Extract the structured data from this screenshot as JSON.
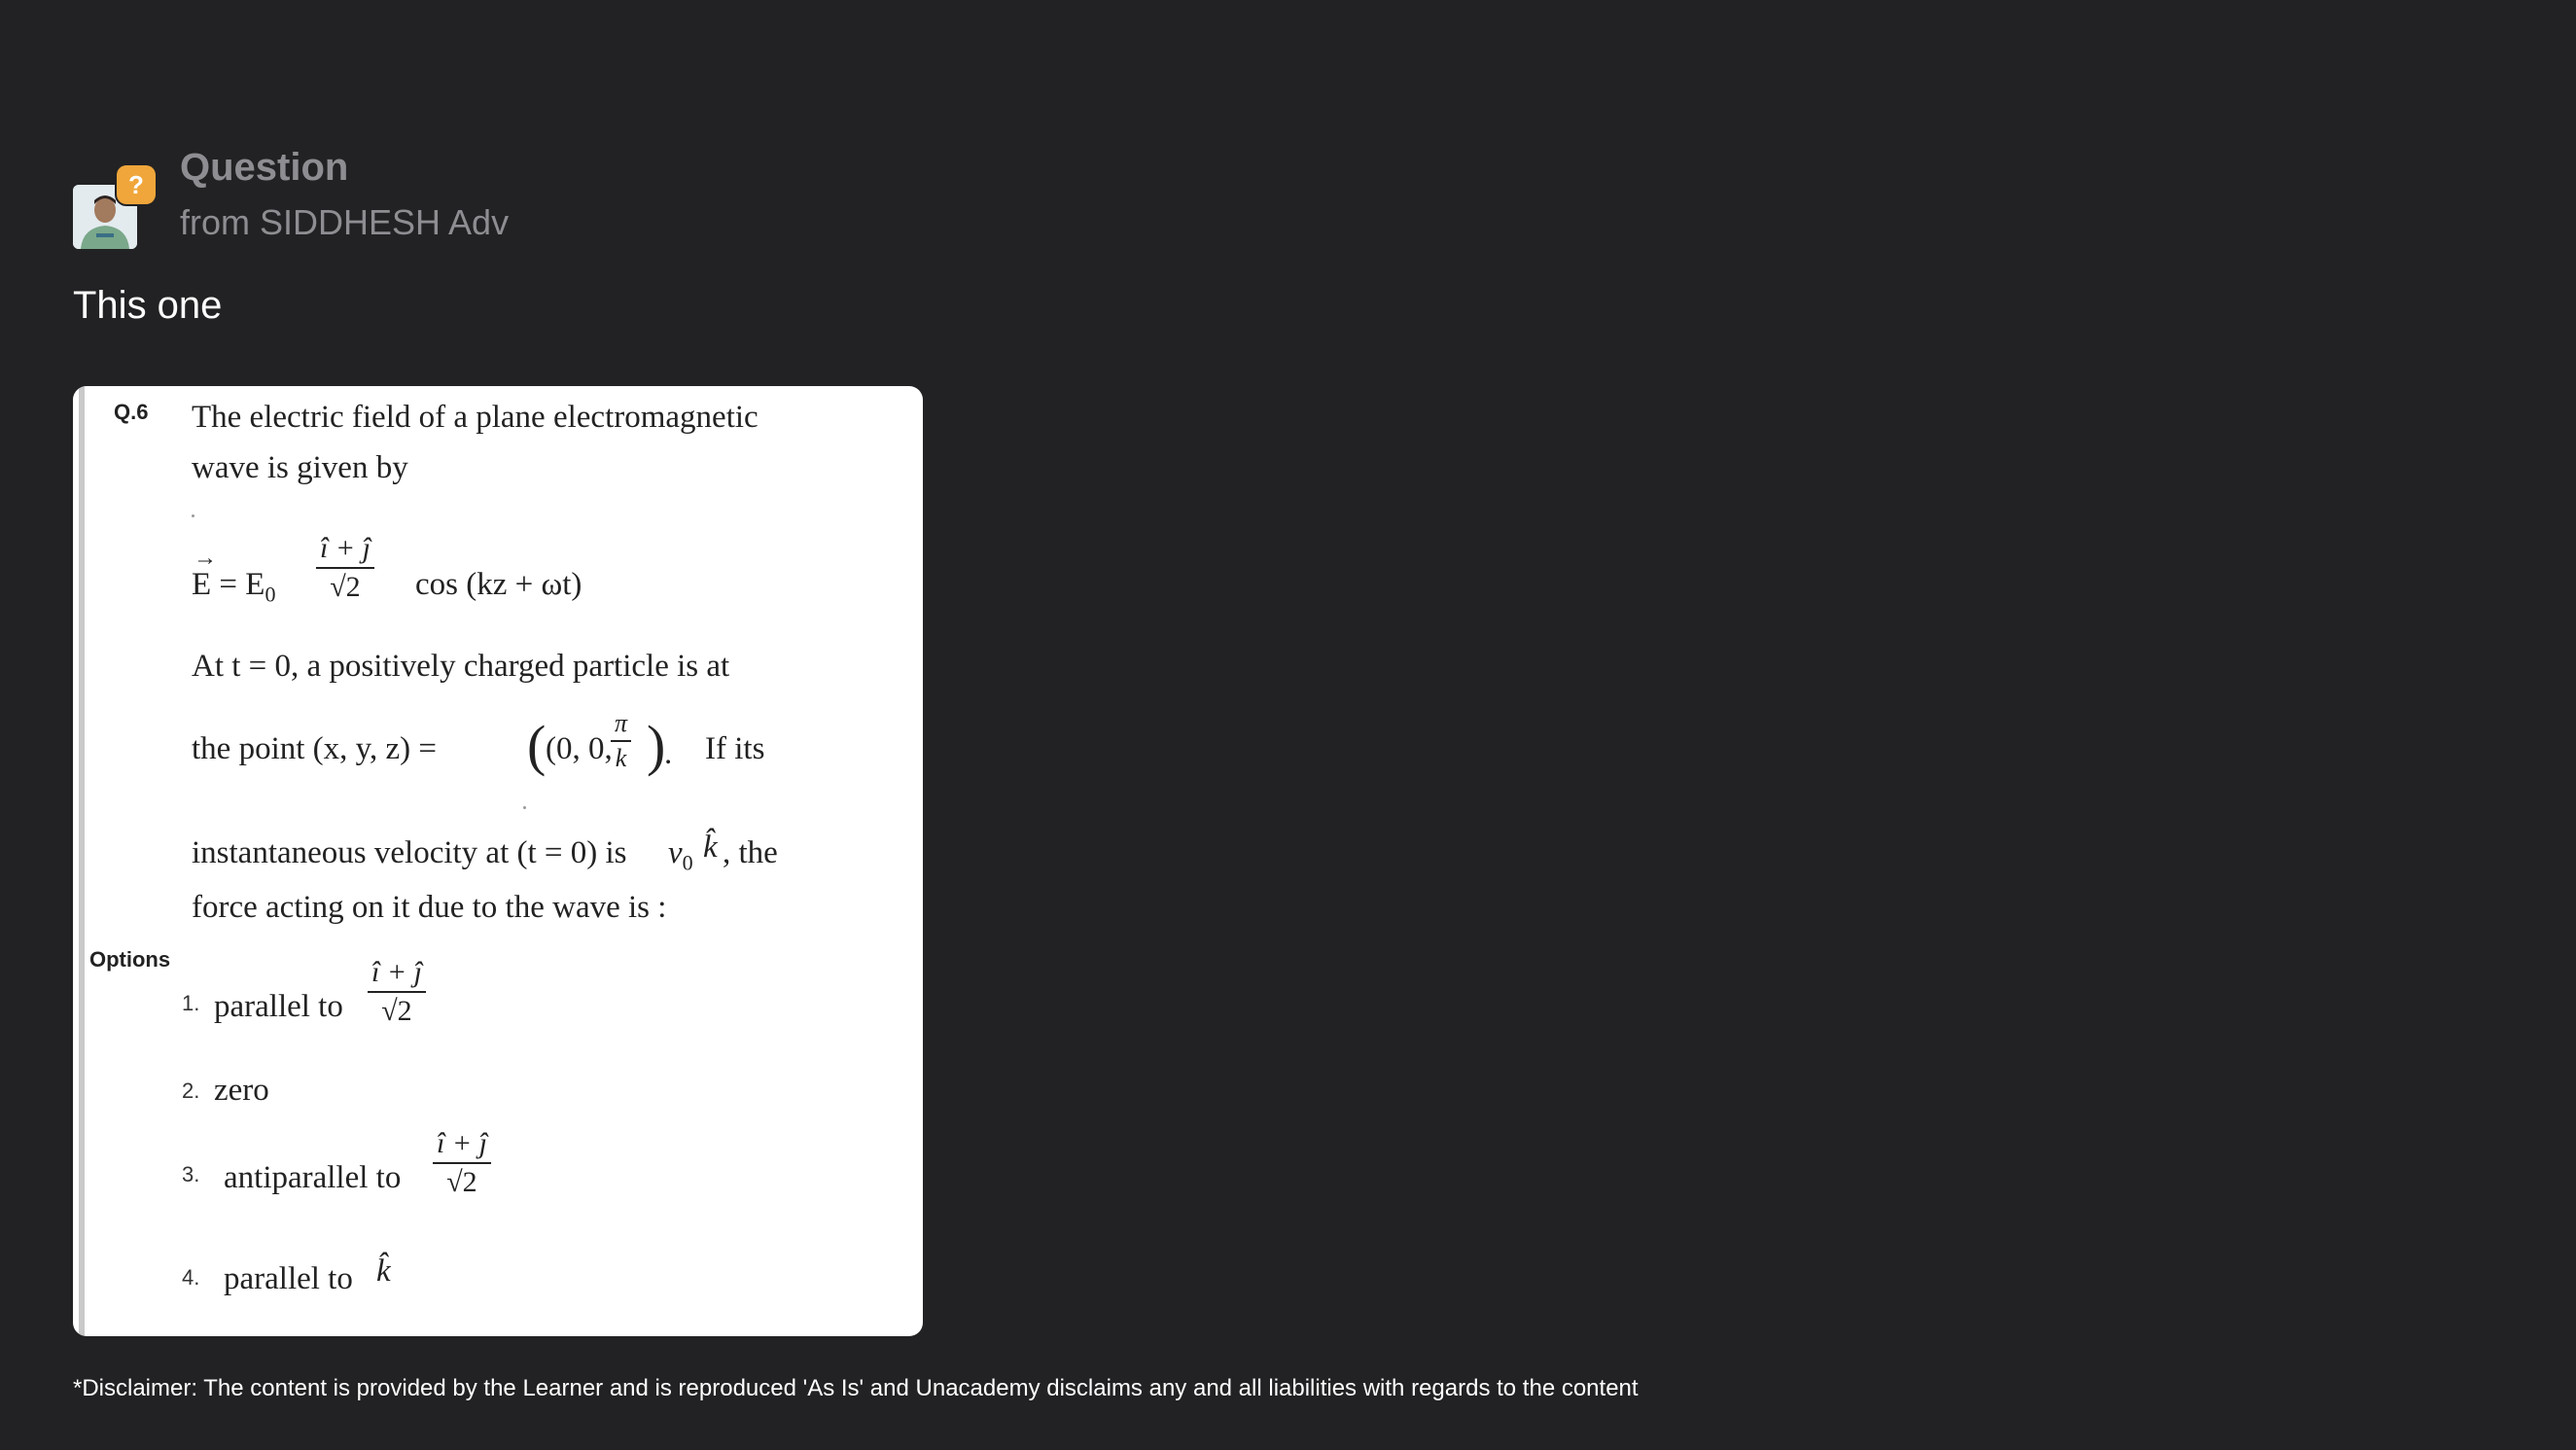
{
  "header": {
    "title": "Question",
    "subtitle": "from SIDDHESH Adv",
    "badge": "?"
  },
  "message": "This one",
  "question": {
    "number": "Q.6",
    "line1": "The electric field of a plane electromagnetic",
    "line2": "wave is given by",
    "eq_lhs": "E = E",
    "eq_sub": "0",
    "eq_num": "î + ĵ",
    "eq_den": "√2",
    "eq_rhs": "cos (kz + ωt)",
    "line3": "At t = 0, a positively charged particle is at",
    "line4_a": "the  point  (x,  y,  z) =",
    "point_open": "(0, 0,",
    "point_num": "π",
    "point_den": "k",
    "point_close": ").",
    "line4_b": "If  its",
    "line5_a": "instantaneous velocity at (t = 0) is",
    "line5_v": "v",
    "line5_vsub": "0",
    "line5_k": "k̂",
    "line5_b": ", the",
    "line6": "force acting on it due to the wave is :"
  },
  "options": {
    "label": "Options",
    "items": [
      {
        "num": "1.",
        "text": "parallel to",
        "frac_num": "î + ĵ",
        "frac_den": "√2"
      },
      {
        "num": "2.",
        "text": "zero"
      },
      {
        "num": "3.",
        "text": "antiparallel to",
        "frac_num": "î + ĵ",
        "frac_den": "√2"
      },
      {
        "num": "4.",
        "text": "parallel to",
        "suffix": "k̂"
      }
    ]
  },
  "disclaimer": "*Disclaimer: The content is provided by the Learner and is reproduced 'As Is' and Unacademy disclaims any and all liabilities with regards to the content"
}
